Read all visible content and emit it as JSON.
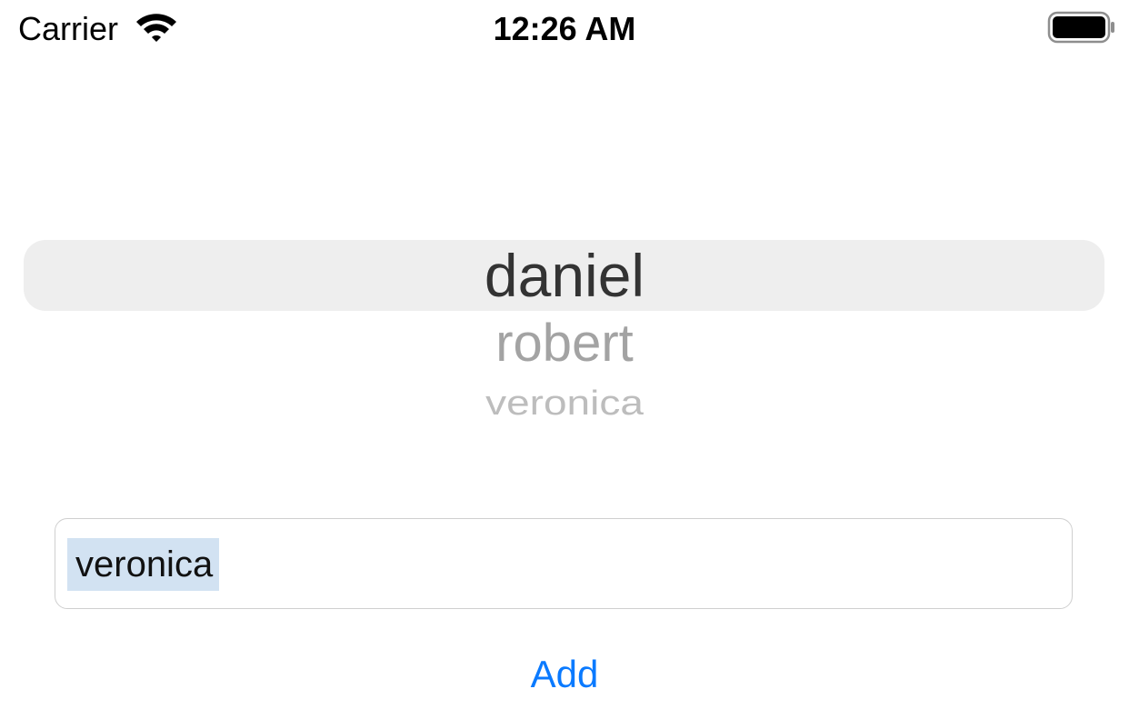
{
  "status_bar": {
    "carrier": "Carrier",
    "time": "12:26 AM",
    "wifi_icon": "wifi-icon",
    "battery_icon": "battery-icon"
  },
  "picker": {
    "selected": "daniel",
    "items": [
      "daniel",
      "robert",
      "veronica"
    ]
  },
  "text_field": {
    "value": "veronica",
    "selection_color": "#d2e2f2"
  },
  "add_button": {
    "label": "Add",
    "color": "#0a7aff"
  }
}
